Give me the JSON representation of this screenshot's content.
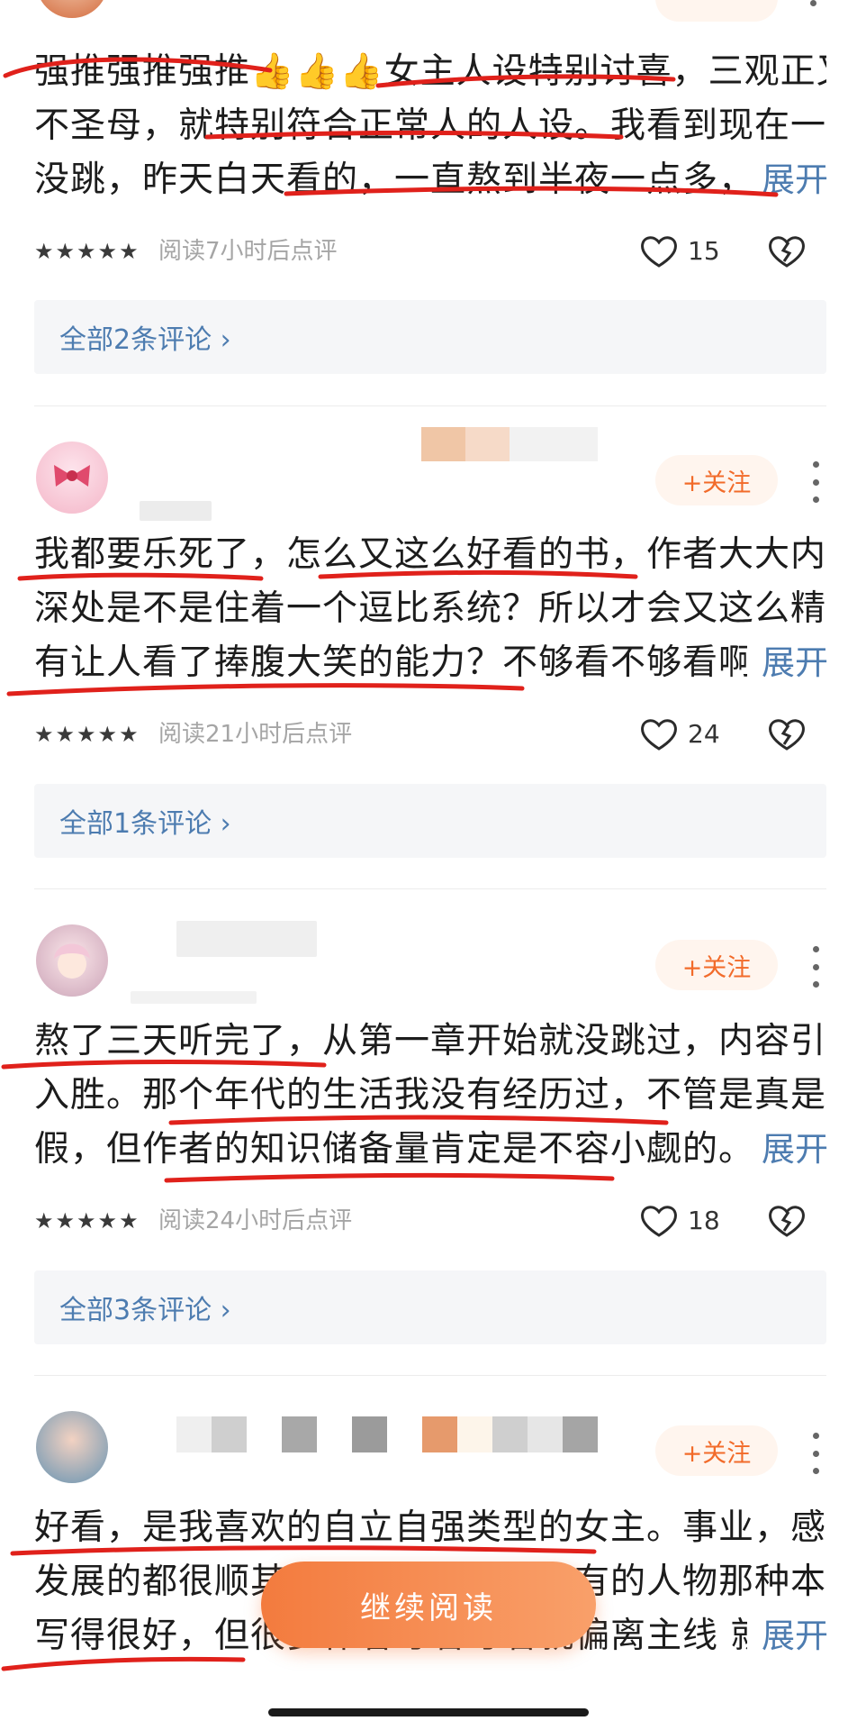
{
  "comments": [
    {
      "lines": [
        "强推强推强推👍👍👍女主人设特别讨喜，三观正又",
        "不圣母，就特别符合正常人的人设。我看到现在一章",
        "没跳，昨天白天看的，一直熬到半夜一点多，"
      ],
      "expand": "展开",
      "stars": "★★★★★",
      "meta": "阅读7小时后点评",
      "likes": "15",
      "replies": "全部2条评论 ›"
    },
    {
      "follow": "+关注",
      "lines": [
        "我都要乐死了，怎么又这么好看的书，作者大大内心",
        "深处是不是住着一个逗比系统？所以才会又这么精彩",
        "有让人看了捧腹大笑的能力？不够看不够看啊，"
      ],
      "expand": "展开",
      "stars": "★★★★★",
      "meta": "阅读21小时后点评",
      "likes": "24",
      "replies": "全部1条评论 ›"
    },
    {
      "follow": "+关注",
      "lines": [
        "熬了三天听完了，从第一章开始就没跳过，内容引人",
        "入胜。那个年代的生活我没有经历过，不管是真是",
        "假，但作者的知识储备量肯定是不容小觑的。"
      ],
      "expand": "展开",
      "stars": "★★★★★",
      "meta": "阅读24小时后点评",
      "likes": "18",
      "replies": "全部3条评论 ›"
    },
    {
      "follow": "+关注",
      "lines": [
        "好看，是我喜欢的自立自强类型的女主。事业，感情",
        "发展的都很顺其自然，不像有些书有的人物那种本来可以",
        "写得很好，但很多作者写着写着就偏离主线 就显得"
      ],
      "expand": "展开"
    }
  ],
  "cta": "继续阅读",
  "colors": {
    "accent": "#f26b2a",
    "link": "#4d7cb0",
    "annotation": "#e0211b"
  }
}
